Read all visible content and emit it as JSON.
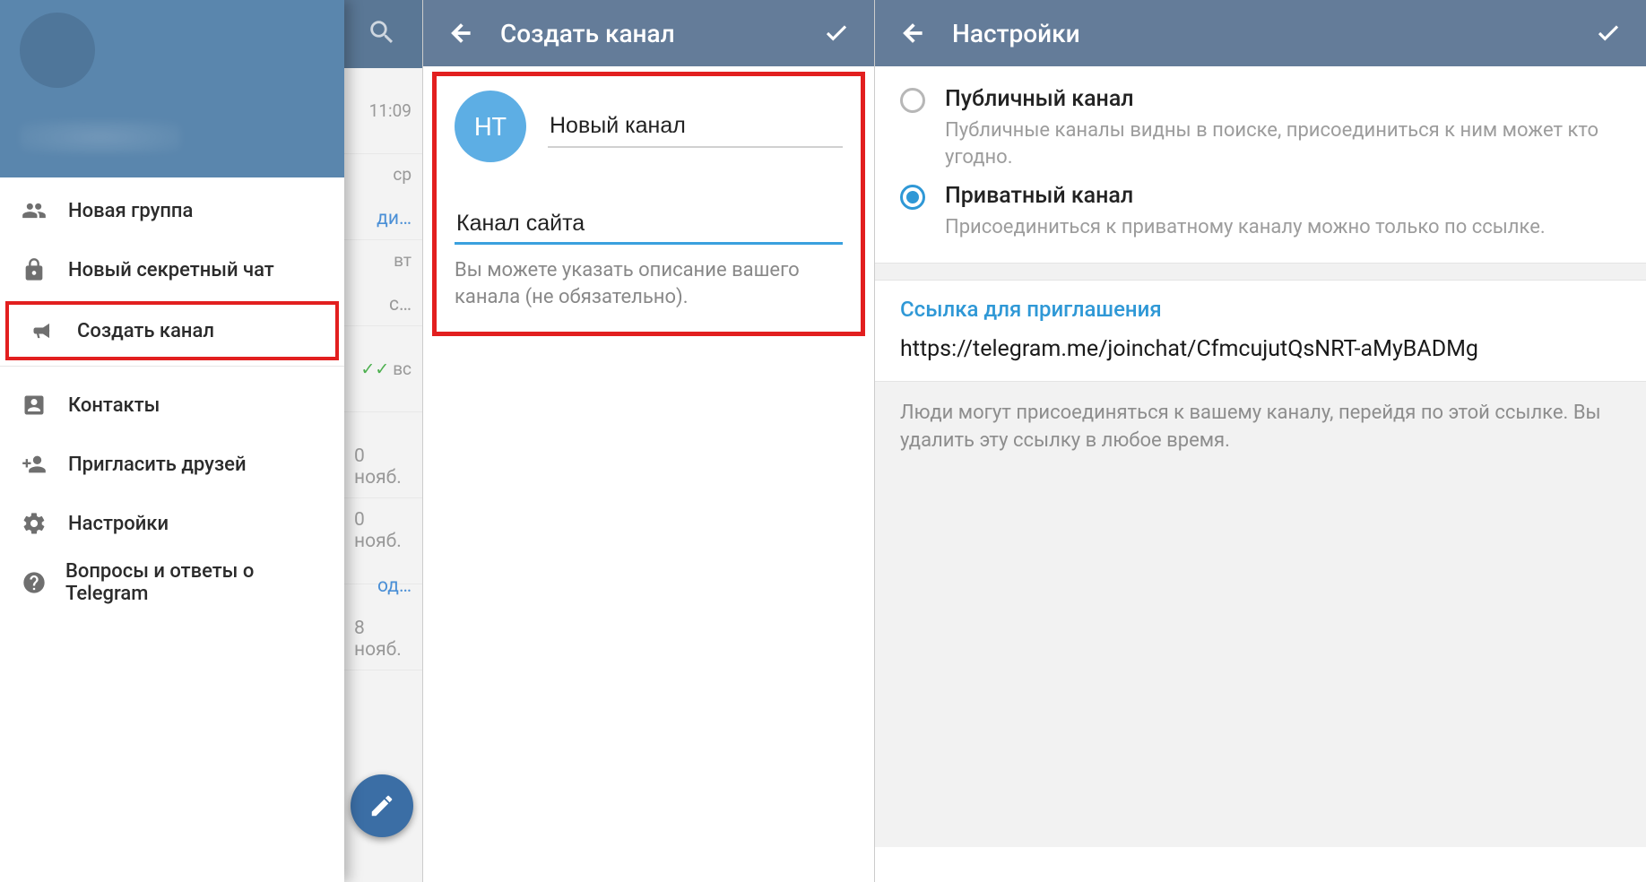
{
  "panel1": {
    "chatPreview": {
      "rows": [
        {
          "time": "11:09",
          "line2": ""
        },
        {
          "time": "ср",
          "line2": "ди…"
        },
        {
          "time": "вт",
          "line2": "с…"
        },
        {
          "time": "вс",
          "line2": "",
          "ticks": "✓✓"
        },
        {
          "time": "",
          "line2": "0 нояб."
        },
        {
          "time": "",
          "line2": "0 нояб."
        },
        {
          "time": "",
          "line2": "од…"
        },
        {
          "time": "",
          "line2": "8 нояб."
        }
      ]
    },
    "menu": {
      "new_group": "Новая группа",
      "new_secret": "Новый секретный чат",
      "create_channel": "Создать канал",
      "contacts": "Контакты",
      "invite": "Пригласить друзей",
      "settings": "Настройки",
      "faq": "Вопросы и ответы о Telegram"
    }
  },
  "panel2": {
    "title": "Создать канал",
    "avatar_initials": "НТ",
    "channel_name": "Новый канал",
    "description_value": "Канал сайта",
    "help_text": "Вы можете указать описание вашего канала (не обязательно)."
  },
  "panel3": {
    "title": "Настройки",
    "public": {
      "title": "Публичный канал",
      "sub": "Публичные каналы видны в поиске, присоединиться к ним может кто угодно."
    },
    "private": {
      "title": "Приватный канал",
      "sub": "Присоединиться к приватному каналу можно только по ссылке."
    },
    "link_section_title": "Ссылка для приглашения",
    "link_value": "https://telegram.me/joinchat/CfmcujutQsNRT-aMyBADMg",
    "footer_text": "Люди могут присоединяться к вашему каналу, перейдя по этой ссылке. Вы удалить эту ссылку в любое время."
  }
}
